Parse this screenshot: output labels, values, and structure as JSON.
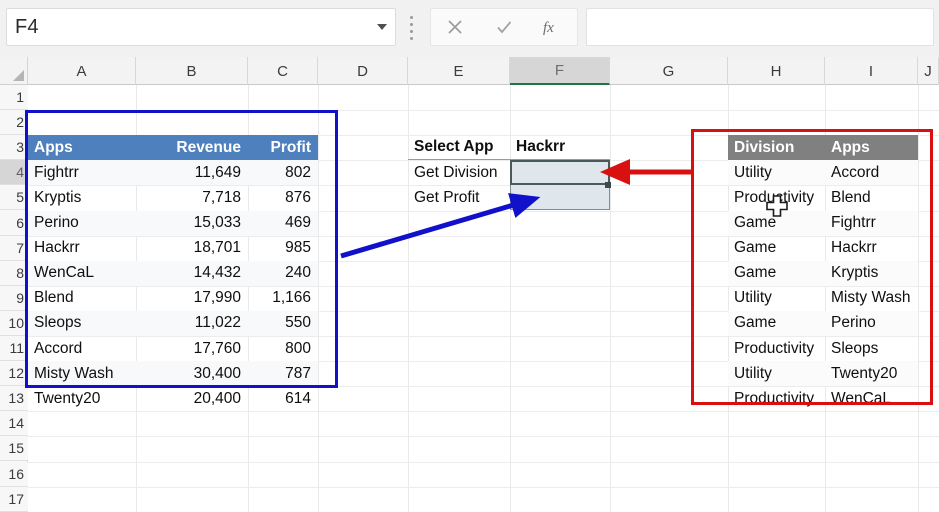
{
  "app": {
    "name_box_value": "F4",
    "formula_bar_value": "",
    "formula_bar_placeholder": "",
    "icons": {
      "name_box_dropdown": "chevron-down-icon",
      "cancel": "close-icon",
      "confirm": "check-icon",
      "insert_function": "fx-icon",
      "grip": "drag-grip-icon",
      "select_all": "select-all-corner-icon",
      "mouse_cursor": "excel-cross-cursor-icon"
    }
  },
  "grid": {
    "columns": [
      "A",
      "B",
      "C",
      "D",
      "E",
      "F",
      "G",
      "H",
      "I",
      "J"
    ],
    "selected_column": "F",
    "rows": [
      "1",
      "2",
      "3",
      "4",
      "5",
      "6",
      "7",
      "8",
      "9",
      "10",
      "11",
      "12",
      "13",
      "14",
      "15",
      "16",
      "17"
    ],
    "selected_row": "4"
  },
  "selection": {
    "active_cell": "F4",
    "range": "F4:F5"
  },
  "apps_table": {
    "headers": [
      "Apps",
      "Revenue",
      "Profit"
    ],
    "header_fill": "#4e80bd",
    "rows": [
      {
        "app": "Fightrr",
        "revenue": "11,649",
        "profit": "802"
      },
      {
        "app": "Kryptis",
        "revenue": "7,718",
        "profit": "876"
      },
      {
        "app": "Perino",
        "revenue": "15,033",
        "profit": "469"
      },
      {
        "app": "Hackrr",
        "revenue": "18,701",
        "profit": "985"
      },
      {
        "app": "WenCaL",
        "revenue": "14,432",
        "profit": "240"
      },
      {
        "app": "Blend",
        "revenue": "17,990",
        "profit": "1,166"
      },
      {
        "app": "Sleops",
        "revenue": "11,022",
        "profit": "550"
      },
      {
        "app": "Accord",
        "revenue": "17,760",
        "profit": "800"
      },
      {
        "app": "Misty Wash",
        "revenue": "30,400",
        "profit": "787"
      },
      {
        "app": "Twenty20",
        "revenue": "20,400",
        "profit": "614"
      }
    ]
  },
  "lookup_panel": {
    "select_app_label": "Select App",
    "select_app_value": "Hackrr",
    "get_division_label": "Get Division",
    "get_division_value": "",
    "get_profit_label": "Get Profit",
    "get_profit_value": ""
  },
  "division_table": {
    "headers": [
      "Division",
      "Apps"
    ],
    "header_fill": "#808080",
    "rows": [
      {
        "division": "Utility",
        "app": "Accord"
      },
      {
        "division": "Productivity",
        "app": "Blend"
      },
      {
        "division": "Game",
        "app": "Fightrr"
      },
      {
        "division": "Game",
        "app": "Hackrr"
      },
      {
        "division": "Game",
        "app": "Kryptis"
      },
      {
        "division": "Utility",
        "app": "Misty Wash"
      },
      {
        "division": "Game",
        "app": "Perino"
      },
      {
        "division": "Productivity",
        "app": "Sleops"
      },
      {
        "division": "Utility",
        "app": "Twenty20"
      },
      {
        "division": "Productivity",
        "app": "WenCaL"
      }
    ]
  },
  "annotations": {
    "blue_box_color": "#1111cc",
    "red_box_color": "#d81010",
    "blue_arrow_color": "#1111cc",
    "red_arrow_color": "#d81010"
  }
}
